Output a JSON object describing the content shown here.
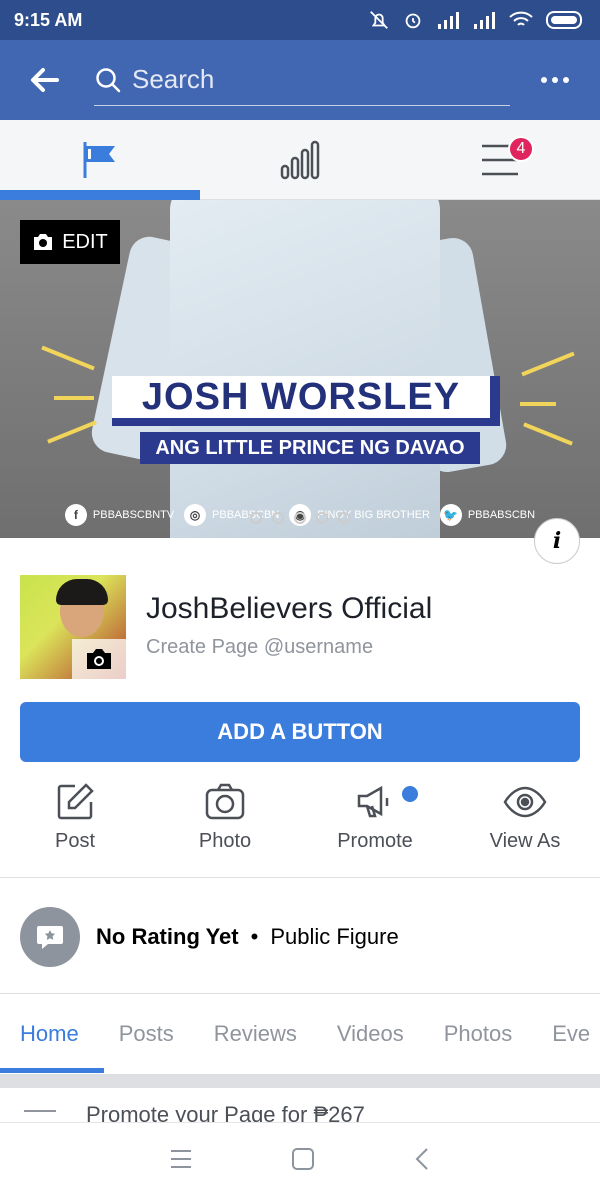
{
  "status_bar": {
    "time": "9:15 AM"
  },
  "app_bar": {
    "search_placeholder": "Search"
  },
  "tabs": {
    "menu_badge_count": "4"
  },
  "cover": {
    "edit_label": "EDIT",
    "title": "JOSH WORSLEY",
    "subtitle": "ANG LITTLE PRINCE NG DAVAO",
    "social": [
      {
        "icon": "f",
        "label": "PBBABSCBNTV"
      },
      {
        "icon": "◎",
        "label": "PBBABSCBN"
      },
      {
        "icon": "◉",
        "label": "PINOY BIG BROTHER"
      },
      {
        "icon": "🐦",
        "label": "PBBABSCBN"
      }
    ],
    "info_label": "i"
  },
  "page": {
    "name": "JoshBelievers Official",
    "username_prompt": "Create Page @username"
  },
  "add_button": {
    "label": "ADD A BUTTON"
  },
  "actions": [
    {
      "label": "Post",
      "icon": "edit-icon"
    },
    {
      "label": "Photo",
      "icon": "camera-icon"
    },
    {
      "label": "Promote",
      "icon": "megaphone-icon"
    },
    {
      "label": "View As",
      "icon": "eye-icon"
    }
  ],
  "rating": {
    "status": "No Rating Yet",
    "separator": "•",
    "category": "Public Figure"
  },
  "page_tabs": [
    "Home",
    "Posts",
    "Reviews",
    "Videos",
    "Photos",
    "Eve"
  ],
  "promote_peek": "Promote your Page for ₱267",
  "colors": {
    "brand": "#4267b2",
    "accent": "#3b7ddd",
    "badge": "#e0245e"
  }
}
